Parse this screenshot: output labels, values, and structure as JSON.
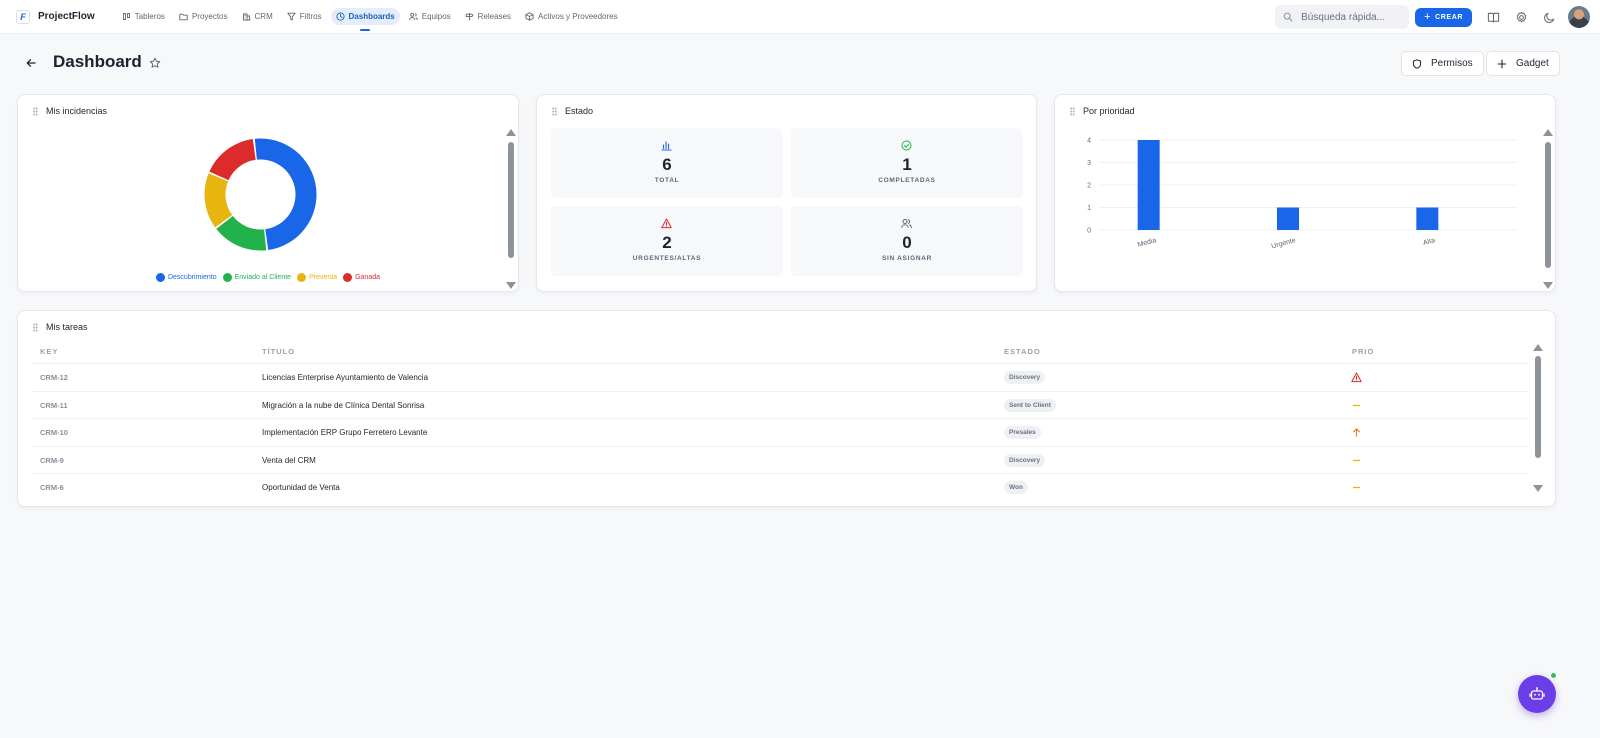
{
  "app": {
    "name": "ProjectFlow",
    "logo_text": "F"
  },
  "nav": {
    "items": [
      {
        "label": "Tableros",
        "icon": "board-icon",
        "active": false
      },
      {
        "label": "Proyectos",
        "icon": "folder-icon",
        "active": false
      },
      {
        "label": "CRM",
        "icon": "building-icon",
        "active": false
      },
      {
        "label": "Filtros",
        "icon": "filter-icon",
        "active": false
      },
      {
        "label": "Dashboards",
        "icon": "dashboard-icon",
        "active": true
      },
      {
        "label": "Equipos",
        "icon": "team-icon",
        "active": false
      },
      {
        "label": "Releases",
        "icon": "signpost-icon",
        "active": false
      },
      {
        "label": "Activos y Proveedores",
        "icon": "package-icon",
        "active": false
      }
    ]
  },
  "topbar": {
    "search_placeholder": "Búsqueda rápida...",
    "create_label": "CREAR"
  },
  "header": {
    "title": "Dashboard",
    "permissions_label": "Permisos",
    "gadget_label": "Gadget"
  },
  "widgets": {
    "incidencias": {
      "title": "Mis incidencias",
      "chart_data": {
        "type": "pie",
        "donut": true,
        "categories": [
          "Descubrimiento",
          "Enviado al Cliente",
          "Preventa",
          "Ganada"
        ],
        "values": [
          3,
          1,
          1,
          1
        ],
        "colors": [
          "#1a66e8",
          "#22b24c",
          "#e8b40e",
          "#dc2b2b"
        ],
        "legend": "bottom"
      }
    },
    "estado": {
      "title": "Estado",
      "tiles": [
        {
          "value": "6",
          "label": "TOTAL",
          "icon": "bar-chart-icon"
        },
        {
          "value": "1",
          "label": "COMPLETADAS",
          "icon": "check-circle-icon"
        },
        {
          "value": "2",
          "label": "URGENTES/ALTAS",
          "icon": "alert-triangle-icon"
        },
        {
          "value": "0",
          "label": "SIN ASIGNAR",
          "icon": "users-icon"
        }
      ]
    },
    "prioridad": {
      "title": "Por prioridad",
      "chart_data": {
        "type": "bar",
        "categories": [
          "Media",
          "Urgente",
          "Alta"
        ],
        "values": [
          4,
          1,
          1
        ],
        "ylim": [
          0,
          4
        ],
        "yticks": [
          0,
          1,
          2,
          3,
          4
        ],
        "grid": true,
        "color": "#1a66e8"
      }
    },
    "tareas": {
      "title": "Mis tareas",
      "columns": [
        "KEY",
        "TÍTULO",
        "ESTADO",
        "PRIO"
      ],
      "rows": [
        {
          "key": "CRM-12",
          "title": "Licencias Enterprise Ayuntamiento de Valencia",
          "status": "Discovery",
          "prio": "urgent"
        },
        {
          "key": "CRM-11",
          "title": "Migración a la nube de Clínica Dental Sonrisa",
          "status": "Sent to Client",
          "prio": "medium"
        },
        {
          "key": "CRM-10",
          "title": "Implementación ERP Grupo Ferretero Levante",
          "status": "Presales",
          "prio": "high"
        },
        {
          "key": "CRM-9",
          "title": "Venta del CRM",
          "status": "Discovery",
          "prio": "medium"
        },
        {
          "key": "CRM-6",
          "title": "Oportunidad de Venta",
          "status": "Won",
          "prio": "medium"
        }
      ]
    }
  }
}
